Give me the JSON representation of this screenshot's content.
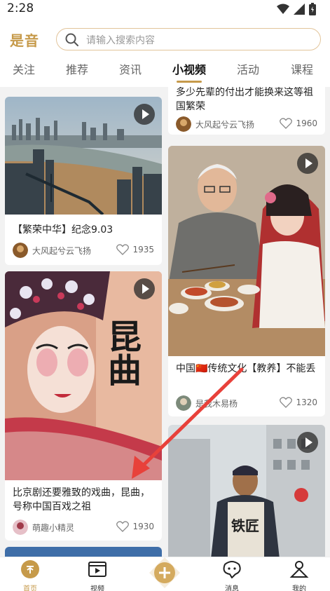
{
  "status": {
    "time": "2:28"
  },
  "header": {
    "logo": "是音",
    "search_placeholder": "请输入搜索内容"
  },
  "tabs": [
    {
      "label": "关注"
    },
    {
      "label": "推荐"
    },
    {
      "label": "资讯"
    },
    {
      "label": "小视频",
      "active": true
    },
    {
      "label": "活动"
    },
    {
      "label": "课程"
    }
  ],
  "feed": {
    "top_right_partial": {
      "title": "多少先辈的付出才能换来这等祖国繁荣",
      "author": "大风起兮云飞扬",
      "likes": "1960"
    },
    "cards": [
      {
        "title": "【繁荣中华】纪念9.03",
        "author": "大风起兮云飞扬",
        "likes": "1935",
        "image": "city-river-bridge"
      },
      {
        "title": "中国🇨🇳传统文化【教养】不能丢",
        "author": "是我木易杨",
        "likes": "1320",
        "image": "grandfather-and-girl-dining"
      },
      {
        "title": "比京剧还要雅致的戏曲，昆曲，号称中国百戏之祖",
        "author": "萌趣小精灵",
        "likes": "1930",
        "image": "kunqu-opera-performer",
        "overlay_text": "昆曲"
      },
      {
        "title": "",
        "author": "",
        "likes": "",
        "image": "blacksmith-street",
        "overlay_text": "铁匠"
      }
    ]
  },
  "tabbar": [
    {
      "label": "首页",
      "icon": "home-icon",
      "active": true
    },
    {
      "label": "视频",
      "icon": "video-icon"
    },
    {
      "label": "",
      "icon": "plus-icon"
    },
    {
      "label": "消息",
      "icon": "message-icon"
    },
    {
      "label": "我的",
      "icon": "profile-icon"
    }
  ],
  "colors": {
    "accent": "#c69a4a",
    "annotation_arrow": "#e8413a"
  }
}
